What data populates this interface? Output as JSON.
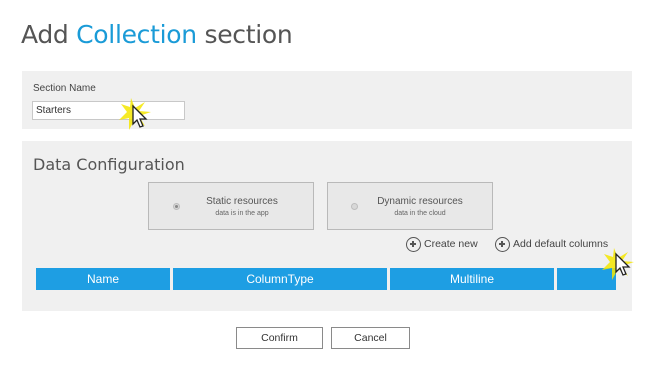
{
  "page": {
    "title_prefix": "Add ",
    "title_accent": "Collection",
    "title_suffix": " section"
  },
  "section_name": {
    "label": "Section Name",
    "value": "Starters"
  },
  "data_config": {
    "heading": "Data Configuration",
    "options": [
      {
        "title": "Static resources",
        "subtitle": "data is in the app",
        "selected": true
      },
      {
        "title": "Dynamic resources",
        "subtitle": "data in the cloud",
        "selected": false
      }
    ],
    "create_new_label": "Create new",
    "add_default_label": "Add default columns",
    "columns": [
      "Name",
      "ColumnType",
      "Multiline",
      ""
    ]
  },
  "footer": {
    "confirm_label": "Confirm",
    "cancel_label": "Cancel"
  },
  "colors": {
    "accent": "#1a9bd7",
    "table_header": "#1e9ee3",
    "panel_bg": "#f0f0f0",
    "cursor_highlight": "#f5e600"
  },
  "icons": {
    "add": "circle-plus-icon",
    "cursor": "mouse-pointer-icon"
  }
}
